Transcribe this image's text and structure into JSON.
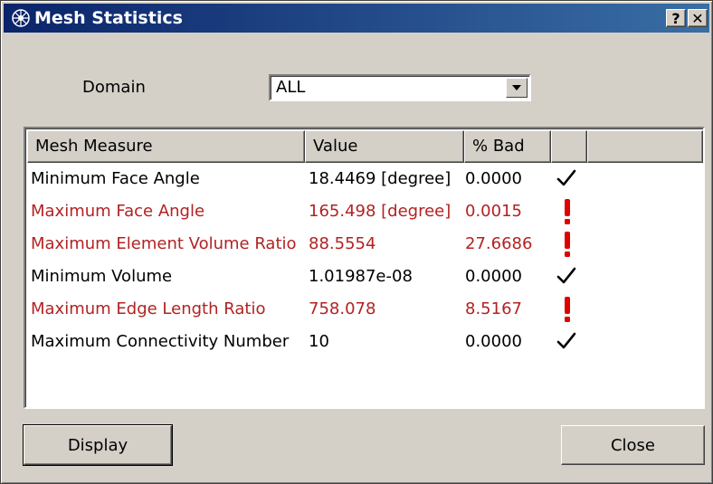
{
  "window": {
    "title": "Mesh Statistics",
    "help_label": "?",
    "close_label": "✕"
  },
  "domain": {
    "label": "Domain",
    "value": "ALL"
  },
  "table": {
    "headers": [
      "Mesh Measure",
      "Value",
      "% Bad",
      "",
      ""
    ],
    "rows": [
      {
        "measure": "Minimum Face Angle",
        "value": "18.4469 [degree]",
        "bad": "0.0000",
        "status": "ok"
      },
      {
        "measure": "Maximum Face Angle",
        "value": "165.498 [degree]",
        "bad": "0.0015",
        "status": "warn"
      },
      {
        "measure": "Maximum Element Volume Ratio",
        "value": "88.5554",
        "bad": "27.6686",
        "status": "warn"
      },
      {
        "measure": "Minimum Volume",
        "value": "1.01987e-08",
        "bad": "0.0000",
        "status": "ok"
      },
      {
        "measure": "Maximum Edge Length Ratio",
        "value": "758.078",
        "bad": "8.5167",
        "status": "warn"
      },
      {
        "measure": "Maximum Connectivity Number",
        "value": "10",
        "bad": "0.0000",
        "status": "ok"
      }
    ]
  },
  "buttons": {
    "display": "Display",
    "close": "Close"
  },
  "colors": {
    "bad": "#b22222",
    "ok": "#000000",
    "title_start": "#0a246a",
    "title_end": "#3a6ea5"
  }
}
